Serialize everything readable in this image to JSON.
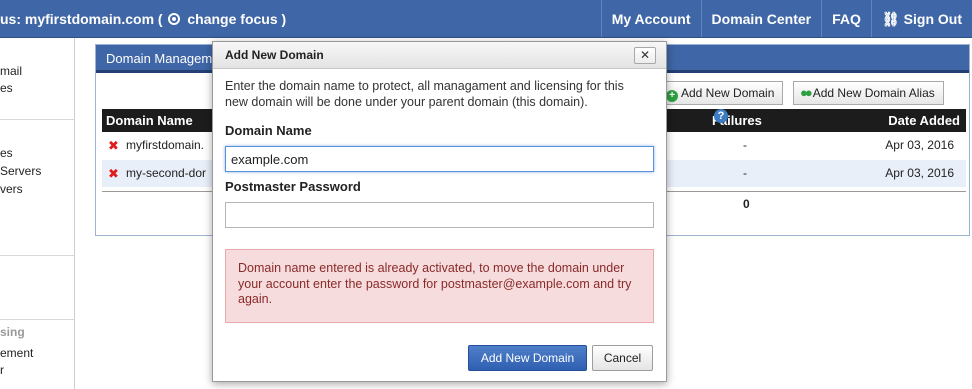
{
  "topbar": {
    "focus_prefix": "us: myfirstdomain.com (",
    "change_focus": "change focus",
    "focus_suffix": ")",
    "nav": {
      "my_account": "My Account",
      "domain_center": "Domain Center",
      "faq": "FAQ",
      "sign_out": "Sign Out"
    }
  },
  "sidebar": {
    "items": [
      "mail",
      "es",
      "es",
      "Servers",
      "vers",
      "sing",
      "ement",
      "r"
    ]
  },
  "panel": {
    "title": "Domain Manageme",
    "add_domain_button": "Add New Domain",
    "add_alias_button": "Add New Domain Alias",
    "columns": {
      "domain_name": "Domain Name",
      "failures": "Failures",
      "date_added": "Date Added"
    },
    "rows": [
      {
        "domain": "myfirstdomain.",
        "failures": "-",
        "date_added": "Apr 03, 2016"
      },
      {
        "domain": "my-second-dor",
        "failures": "-",
        "date_added": "Apr 03, 2016"
      }
    ],
    "total_failures": "0"
  },
  "modal": {
    "title": "Add New Domain",
    "close_glyph": "✕",
    "intro": "Enter the domain name to protect, all managament and licensing for this new domain will be done under your parent domain (this domain).",
    "domain_label": "Domain Name",
    "domain_value": "example.com",
    "password_label": "Postmaster Password",
    "password_value": "",
    "error": "Domain name entered is already activated, to move the domain under your account enter the password for postmaster@example.com and try again.",
    "submit": "Add New Domain",
    "cancel": "Cancel"
  },
  "colors": {
    "nav_blue": "#3f66a6",
    "primary_button": "#2f5fb0",
    "error_bg": "#f6dcdc",
    "error_text": "#8a2a2a",
    "delete_red": "#e11b1b",
    "add_green": "#2ea043"
  }
}
